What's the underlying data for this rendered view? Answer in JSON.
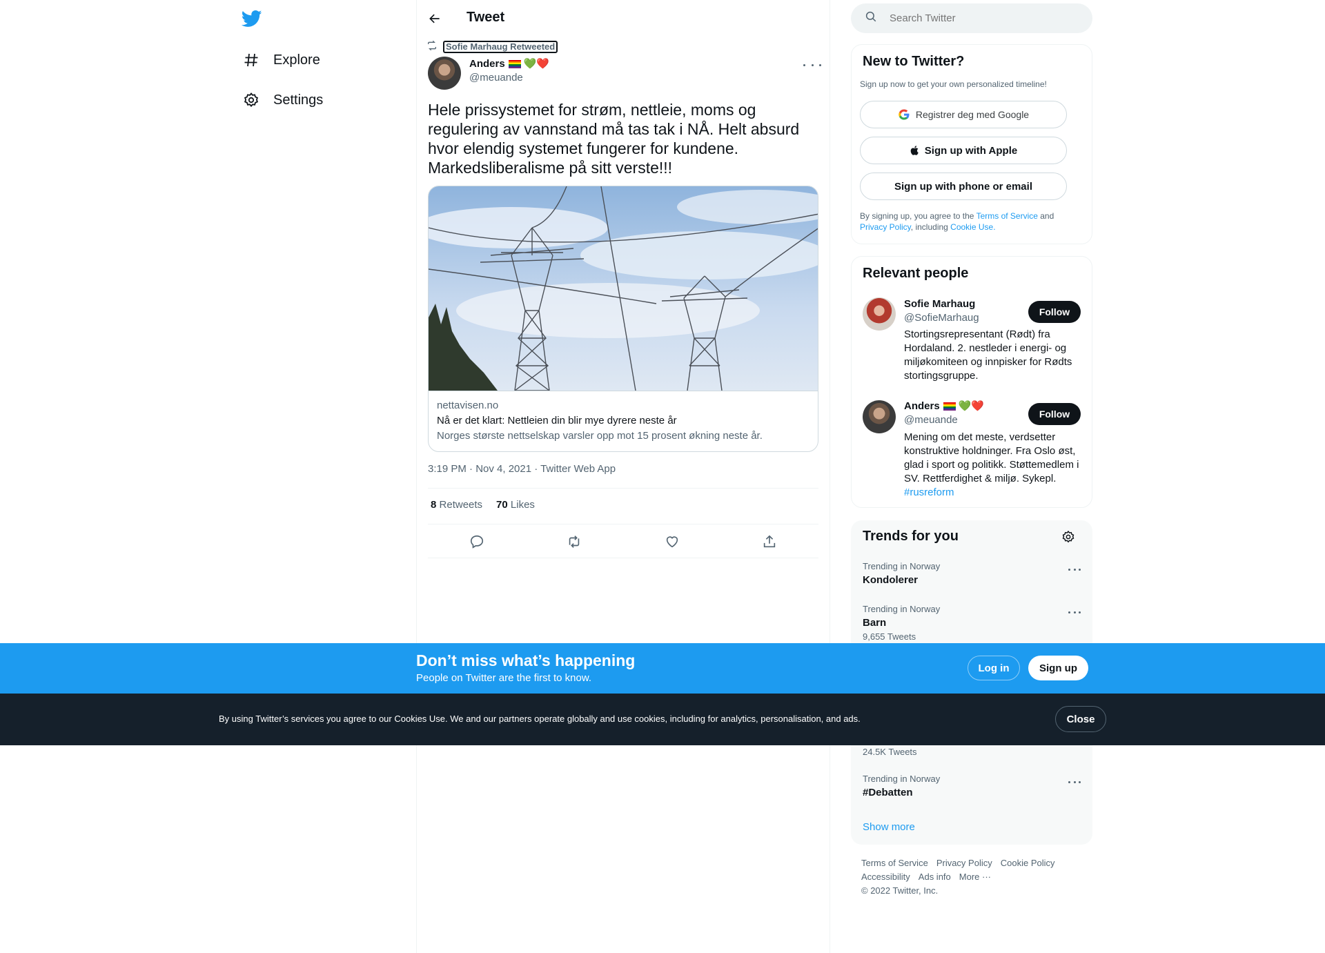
{
  "nav": {
    "logo": "twitter-bird-icon",
    "items": [
      {
        "label": "Explore",
        "icon": "hashtag-icon"
      },
      {
        "label": "Settings",
        "icon": "gear-icon"
      }
    ]
  },
  "header": {
    "title": "Tweet"
  },
  "tweet": {
    "retweeted_by": "Sofie Marhaug Retweeted",
    "author_name": "Anders",
    "author_emoji_hearts": "💚❤️",
    "author_handle": "@meuande",
    "text": "Hele prissystemet for strøm, nettleie, moms og regulering av vannstand må tas tak i NÅ. Helt absurd hvor elendig systemet fungerer for kundene. Markedsliberalisme på sitt verste!!!",
    "card": {
      "domain": "nettavisen.no",
      "title": "Nå er det klart: Nettleien din blir mye dyrere neste år",
      "description": "Norges største nettselskap varsler opp mot 15 prosent økning neste år."
    },
    "meta": "3:19 PM · Nov 4, 2021 · Twitter Web App",
    "retweets_count": "8",
    "retweets_label": "Retweets",
    "likes_count": "70",
    "likes_label": "Likes",
    "actions": [
      "reply-icon",
      "retweet-icon",
      "like-icon",
      "share-icon"
    ]
  },
  "sidebar": {
    "search_placeholder": "Search Twitter",
    "new_to_twitter": {
      "title": "New to Twitter?",
      "subtitle": "Sign up now to get your own personalized timeline!",
      "google_label": "Registrer deg med Google",
      "apple_label": "Sign up with Apple",
      "phone_label": "Sign up with phone or email",
      "legal_prefix": "By signing up, you agree to the ",
      "terms": "Terms of Service",
      "and": " and",
      "privacy": "Privacy Policy",
      "including": ", including ",
      "cookie": "Cookie Use."
    },
    "relevant_people": {
      "title": "Relevant people",
      "people": [
        {
          "name": "Sofie Marhaug",
          "handle": "@SofieMarhaug",
          "bio": "Stortingsrepresentant (Rødt) fra Hordaland. 2. nestleder i energi- og miljøkomiteen og innpisker for Rødts stortingsgruppe.",
          "follow": "Follow"
        },
        {
          "name": "Anders",
          "hearts": "💚❤️",
          "handle": "@meuande",
          "bio": "Mening om det meste, verdsetter konstruktive holdninger. Fra Oslo øst, glad i sport og politikk. Støttemedlem i SV. Rettferdighet & miljø. Sykepl.",
          "bio_link": "#rusreform",
          "follow": "Follow"
        }
      ]
    },
    "trends": {
      "title": "Trends for you",
      "items": [
        {
          "context": "Trending in Norway",
          "name": "Kondolerer",
          "count": ""
        },
        {
          "context": "Trending in Norway",
          "name": "Barn",
          "count": "9,655 Tweets"
        },
        {
          "context": "",
          "name": "",
          "count": "24.5K Tweets"
        },
        {
          "context": "Trending in Norway",
          "name": "#Debatten",
          "count": ""
        }
      ],
      "show_more": "Show more"
    },
    "footer": {
      "links_row1": [
        "Terms of Service",
        "Privacy Policy",
        "Cookie Policy"
      ],
      "links_row2": [
        "Accessibility",
        "Ads info",
        "More ···"
      ],
      "copyright": "© 2022 Twitter, Inc."
    }
  },
  "banner": {
    "title": "Don’t miss what’s happening",
    "subtitle": "People on Twitter are the first to know.",
    "login": "Log in",
    "signup": "Sign up"
  },
  "cookie_bar": {
    "text": "By using Twitter’s services you agree to our Cookies Use. We and our partners operate globally and use cookies, including for analytics, personalisation, and ads.",
    "close": "Close"
  },
  "colors": {
    "brand": "#1d9bf0",
    "text": "#0f1419",
    "muted": "#536471",
    "cookie_bg": "#15202b"
  }
}
